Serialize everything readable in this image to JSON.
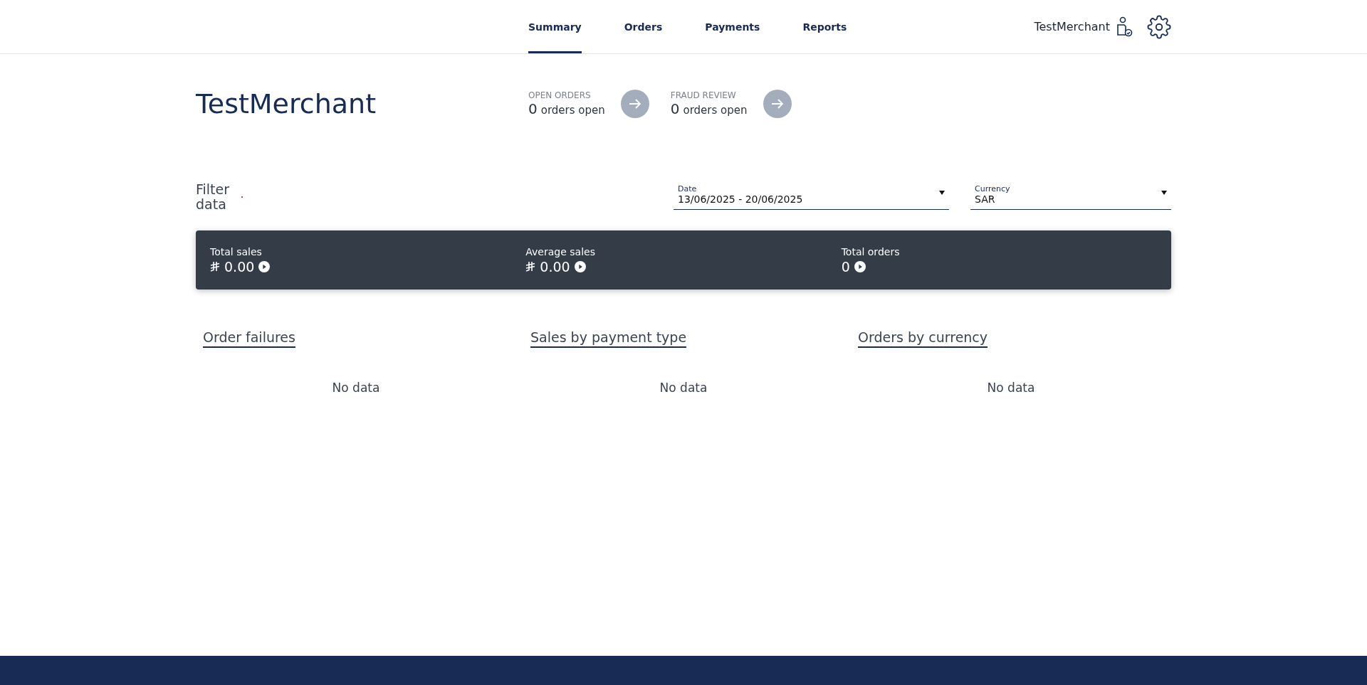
{
  "nav": {
    "tabs": [
      {
        "label": "Summary",
        "selected": true
      },
      {
        "label": "Orders",
        "selected": false
      },
      {
        "label": "Payments",
        "selected": false
      },
      {
        "label": "Reports",
        "selected": false
      }
    ],
    "user": "TestMerchant"
  },
  "merchant_title": "TestMerchant",
  "queues": [
    {
      "label": "OPEN ORDERS",
      "count": "0",
      "unit": "orders open"
    },
    {
      "label": "FRAUD REVIEW",
      "count": "0",
      "unit": "orders open"
    }
  ],
  "filter": {
    "label": "Filter data",
    "date": {
      "label": "Date",
      "value": "13/06/2025 - 20/06/2025"
    },
    "currency": {
      "label": "Currency",
      "value": "SAR"
    }
  },
  "stats": [
    {
      "label": "Total sales",
      "value": "0.00",
      "kind": "money"
    },
    {
      "label": "Average sales",
      "value": "0.00",
      "kind": "money"
    },
    {
      "label": "Total orders",
      "value": "0",
      "kind": "count"
    }
  ],
  "panels": [
    {
      "title": "Order failures",
      "empty": "No data"
    },
    {
      "title": "Sales by payment type",
      "empty": "No data"
    },
    {
      "title": "Orders by currency",
      "empty": "No data"
    }
  ]
}
